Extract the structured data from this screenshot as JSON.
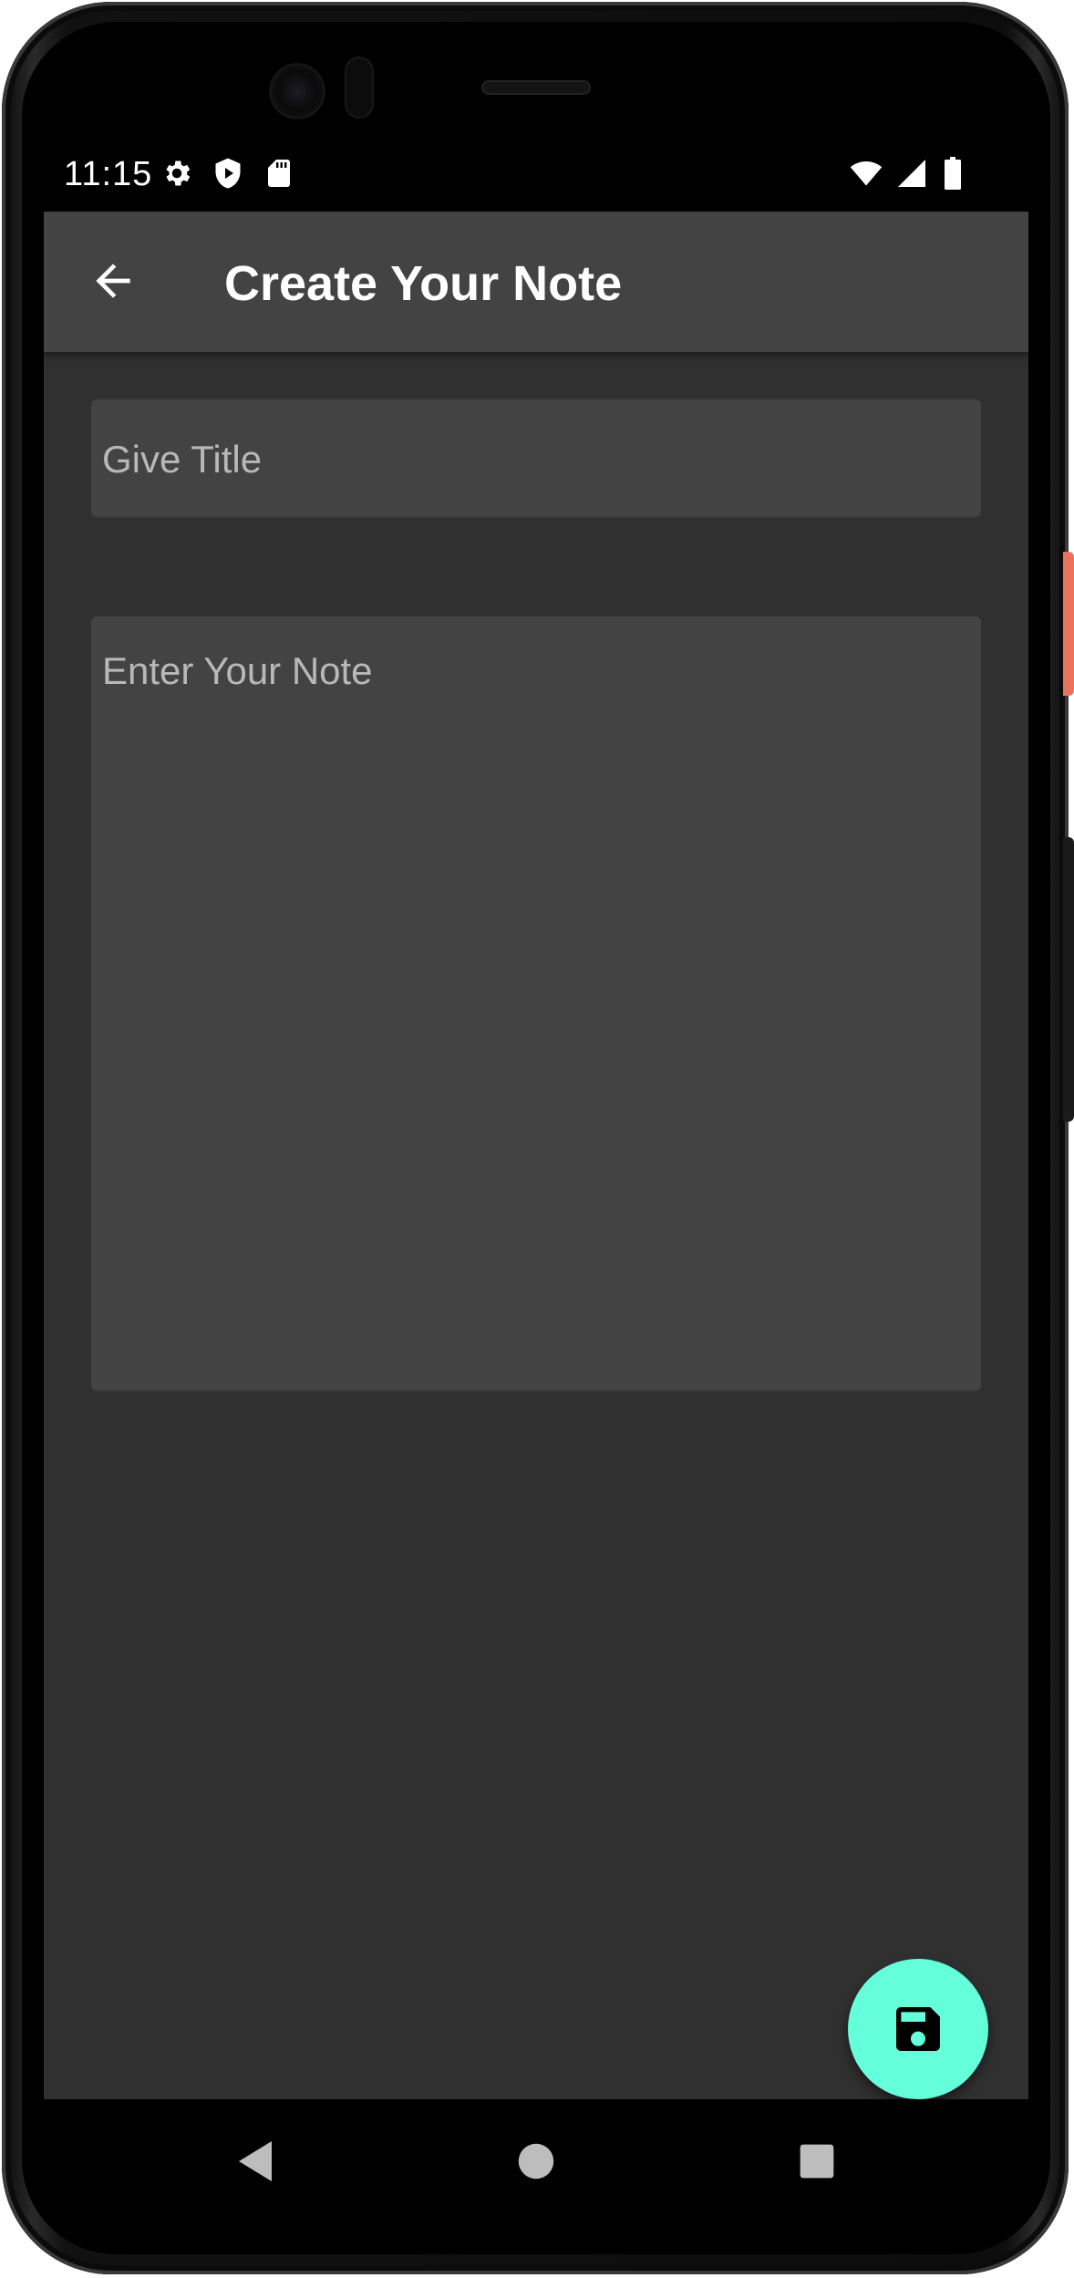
{
  "status_bar": {
    "time": "11:15",
    "left_icons": [
      "gear-icon",
      "shield-play-icon",
      "sd-card-icon"
    ],
    "right_icons": [
      "wifi-icon",
      "cell-signal-icon",
      "battery-icon"
    ]
  },
  "app_bar": {
    "back_icon": "arrow-back-icon",
    "title": "Create Your Note",
    "background": "#434343"
  },
  "form": {
    "title_placeholder": "Give Title",
    "title_value": "",
    "note_placeholder": "Enter Your Note",
    "note_value": "",
    "field_background": "#434343"
  },
  "fab": {
    "icon": "save-icon",
    "color": "#64ffda"
  },
  "nav_bar": {
    "buttons": [
      "back-triangle-icon",
      "home-circle-icon",
      "recents-square-icon"
    ]
  },
  "colors": {
    "screen_background": "#303030",
    "placeholder_text": "#b8b8b8",
    "accent": "#64ffda"
  }
}
